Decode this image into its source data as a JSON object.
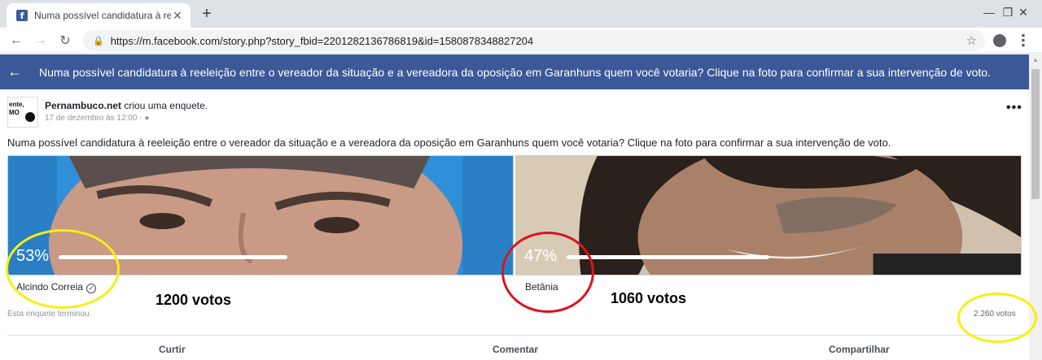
{
  "browser": {
    "tab_title": "Numa possível candidatura à ree",
    "tab_close": "✕",
    "new_tab": "+",
    "url": "https://m.facebook.com/story.php?story_fbid=2201282136786819&id=1580878348827204",
    "window_controls": [
      "—",
      "❐",
      "✕"
    ]
  },
  "fb_header": {
    "title": "Numa possível candidatura à reeleição entre o vereador da situação e a vereadora da oposição em Garanhuns quem você votaria? Clique na foto para confirmar a sua intervenção de voto."
  },
  "post": {
    "avatar_text": "ente,\nMO",
    "author": "Pernambuco.net",
    "action_text": "criou uma enquete.",
    "date": "17 de dezembro às 12:00 ·",
    "text": "Numa possível candidatura à reeleição entre o vereador da situação e a vereadora da oposição em Garanhuns quem você votaria? Clique na foto para confirmar a sua intervenção de voto.",
    "options": [
      {
        "name": "Alcindo Correia",
        "percent_label": "53%",
        "percent": 53,
        "votes_annotation": "1200 votos",
        "selected": true
      },
      {
        "name": "Betânia",
        "percent_label": "47%",
        "percent": 47,
        "votes_annotation": "1060 votos",
        "selected": false
      }
    ],
    "status": "Esta enquete terminou.",
    "total_votes": "2.260 votos",
    "actions": [
      "Curtir",
      "Comentar",
      "Compartilhar"
    ]
  },
  "colors": {
    "facebook_blue": "#3b5998",
    "annotation_yellow": "#f5ef14",
    "annotation_red": "#d9151c",
    "photo1_blue": "#2f8fd8"
  }
}
